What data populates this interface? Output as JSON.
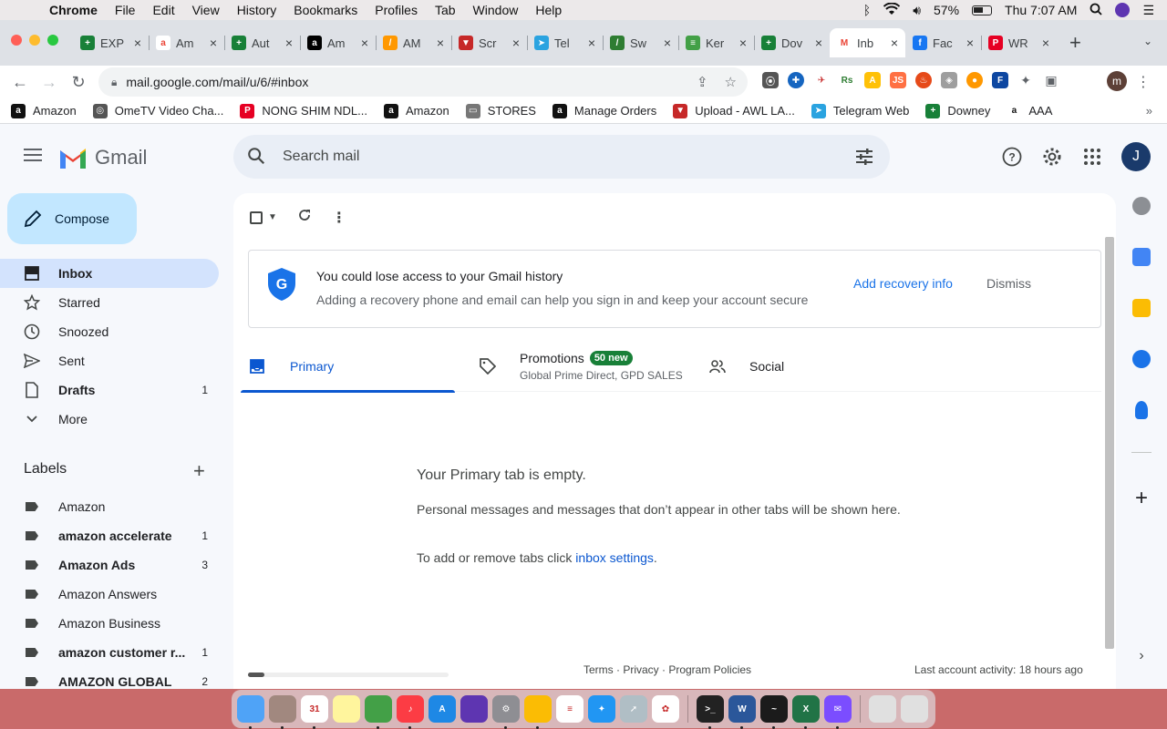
{
  "menubar": {
    "app": "Chrome",
    "items": [
      "File",
      "Edit",
      "View",
      "History",
      "Bookmarks",
      "Profiles",
      "Tab",
      "Window",
      "Help"
    ],
    "battery": "57%",
    "clock": "Thu 7:07 AM"
  },
  "tabs": [
    {
      "title": "EXP",
      "color": "#188038",
      "glyph": "+"
    },
    {
      "title": "Am",
      "color": "#ffffff",
      "glyph": "a"
    },
    {
      "title": "Aut",
      "color": "#188038",
      "glyph": "+"
    },
    {
      "title": "Am",
      "color": "#000000",
      "glyph": "a"
    },
    {
      "title": "AM",
      "color": "#ff9800",
      "glyph": "/"
    },
    {
      "title": "Scr",
      "color": "#c62828",
      "glyph": "▼"
    },
    {
      "title": "Tel",
      "color": "#2aa3e0",
      "glyph": "➤"
    },
    {
      "title": "Sw",
      "color": "#2e7d32",
      "glyph": "/"
    },
    {
      "title": "Ker",
      "color": "#43a047",
      "glyph": "≡"
    },
    {
      "title": "Dov",
      "color": "#188038",
      "glyph": "+"
    },
    {
      "title": "Inb",
      "color": "#ffffff",
      "glyph": "M"
    },
    {
      "title": "Fac",
      "color": "#1877f2",
      "glyph": "f"
    },
    {
      "title": "WR",
      "color": "#e60023",
      "glyph": "P"
    }
  ],
  "omnibox": {
    "url": "mail.google.com/mail/u/6/#inbox"
  },
  "profile_initial": "m",
  "bookmarks": [
    {
      "label": "Amazon",
      "color": "#111111",
      "glyph": "a"
    },
    {
      "label": "OmeTV Video Cha...",
      "color": "#555555",
      "glyph": "◎"
    },
    {
      "label": "NONG SHIM NDL...",
      "color": "#e60023",
      "glyph": "P"
    },
    {
      "label": "Amazon",
      "color": "#111111",
      "glyph": "a"
    },
    {
      "label": "STORES",
      "color": "#777777",
      "glyph": "▭"
    },
    {
      "label": "Manage Orders",
      "color": "#111111",
      "glyph": "a"
    },
    {
      "label": "Upload - AWL LA...",
      "color": "#c62828",
      "glyph": "▼"
    },
    {
      "label": "Telegram Web",
      "color": "#2aa3e0",
      "glyph": "➤"
    },
    {
      "label": "Downey",
      "color": "#188038",
      "glyph": "+"
    },
    {
      "label": "AAA",
      "color": "#ffffff",
      "glyph": "a"
    }
  ],
  "gmail": {
    "brand": "Gmail",
    "search_placeholder": "Search mail",
    "avatar": "J",
    "compose": "Compose",
    "nav": [
      {
        "label": "Inbox",
        "count": "",
        "icon": "inbox-icon"
      },
      {
        "label": "Starred",
        "count": "",
        "icon": "star-icon"
      },
      {
        "label": "Snoozed",
        "count": "",
        "icon": "clock-icon"
      },
      {
        "label": "Sent",
        "count": "",
        "icon": "send-icon"
      },
      {
        "label": "Drafts",
        "count": "1",
        "icon": "draft-icon"
      },
      {
        "label": "More",
        "count": "",
        "icon": "chevron-down-icon"
      }
    ],
    "labels_title": "Labels",
    "labels": [
      {
        "label": "Amazon",
        "count": ""
      },
      {
        "label": "amazon accelerate",
        "count": "1"
      },
      {
        "label": "Amazon Ads",
        "count": "3"
      },
      {
        "label": "Amazon Answers",
        "count": ""
      },
      {
        "label": "Amazon Business",
        "count": ""
      },
      {
        "label": "amazon customer r...",
        "count": "1"
      },
      {
        "label": "AMAZON GLOBAL",
        "count": "2"
      }
    ],
    "banner": {
      "title": "You could lose access to your Gmail history",
      "subtitle": "Adding a recovery phone and email can help you sign in and keep your account secure",
      "action": "Add recovery info",
      "dismiss": "Dismiss"
    },
    "tabs": {
      "primary": "Primary",
      "promotions": "Promotions",
      "promotions_badge": "50 new",
      "promotions_senders": "Global Prime Direct, GPD SALES",
      "social": "Social"
    },
    "empty": {
      "heading": "Your Primary tab is empty.",
      "body": "Personal messages and messages that don’t appear in other tabs will be shown here.",
      "settings_prefix": "To add or remove tabs click ",
      "settings_link": "inbox settings",
      "settings_suffix": "."
    },
    "footer": {
      "links": "Terms · Privacy · Program Policies",
      "activity": "Last account activity: 18 hours ago"
    }
  },
  "dock": [
    {
      "name": "finder",
      "color": "#4fa3f7",
      "glyph": ""
    },
    {
      "name": "notes-brown",
      "color": "#a1887f",
      "glyph": ""
    },
    {
      "name": "calendar",
      "color": "#ffffff",
      "glyph": "31"
    },
    {
      "name": "notes",
      "color": "#fff59d",
      "glyph": ""
    },
    {
      "name": "facetime",
      "color": "#43a047",
      "glyph": ""
    },
    {
      "name": "music",
      "color": "#fc3c44",
      "glyph": "♪"
    },
    {
      "name": "app-store",
      "color": "#1e88e5",
      "glyph": "A"
    },
    {
      "name": "siri",
      "color": "#5e35b1",
      "glyph": ""
    },
    {
      "name": "system-preferences",
      "color": "#8e8e93",
      "glyph": "⚙"
    },
    {
      "name": "chrome",
      "color": "#fbbc04",
      "glyph": ""
    },
    {
      "name": "reminders",
      "color": "#ffffff",
      "glyph": "≡"
    },
    {
      "name": "safari",
      "color": "#2196f3",
      "glyph": "✦"
    },
    {
      "name": "launchpad",
      "color": "#b0bec5",
      "glyph": "➚"
    },
    {
      "name": "photos",
      "color": "#ffffff",
      "glyph": "✿"
    },
    {
      "name": "terminal",
      "color": "#222222",
      "glyph": ">_"
    },
    {
      "name": "word",
      "color": "#2b579a",
      "glyph": "W"
    },
    {
      "name": "activity-monitor",
      "color": "#1b1b1b",
      "glyph": "~"
    },
    {
      "name": "excel",
      "color": "#217346",
      "glyph": "X"
    },
    {
      "name": "messenger",
      "color": "#7b4dff",
      "glyph": "✉"
    },
    {
      "name": "downloads",
      "color": "#e0e0e0",
      "glyph": ""
    },
    {
      "name": "trash",
      "color": "#e0e0e0",
      "glyph": ""
    }
  ]
}
